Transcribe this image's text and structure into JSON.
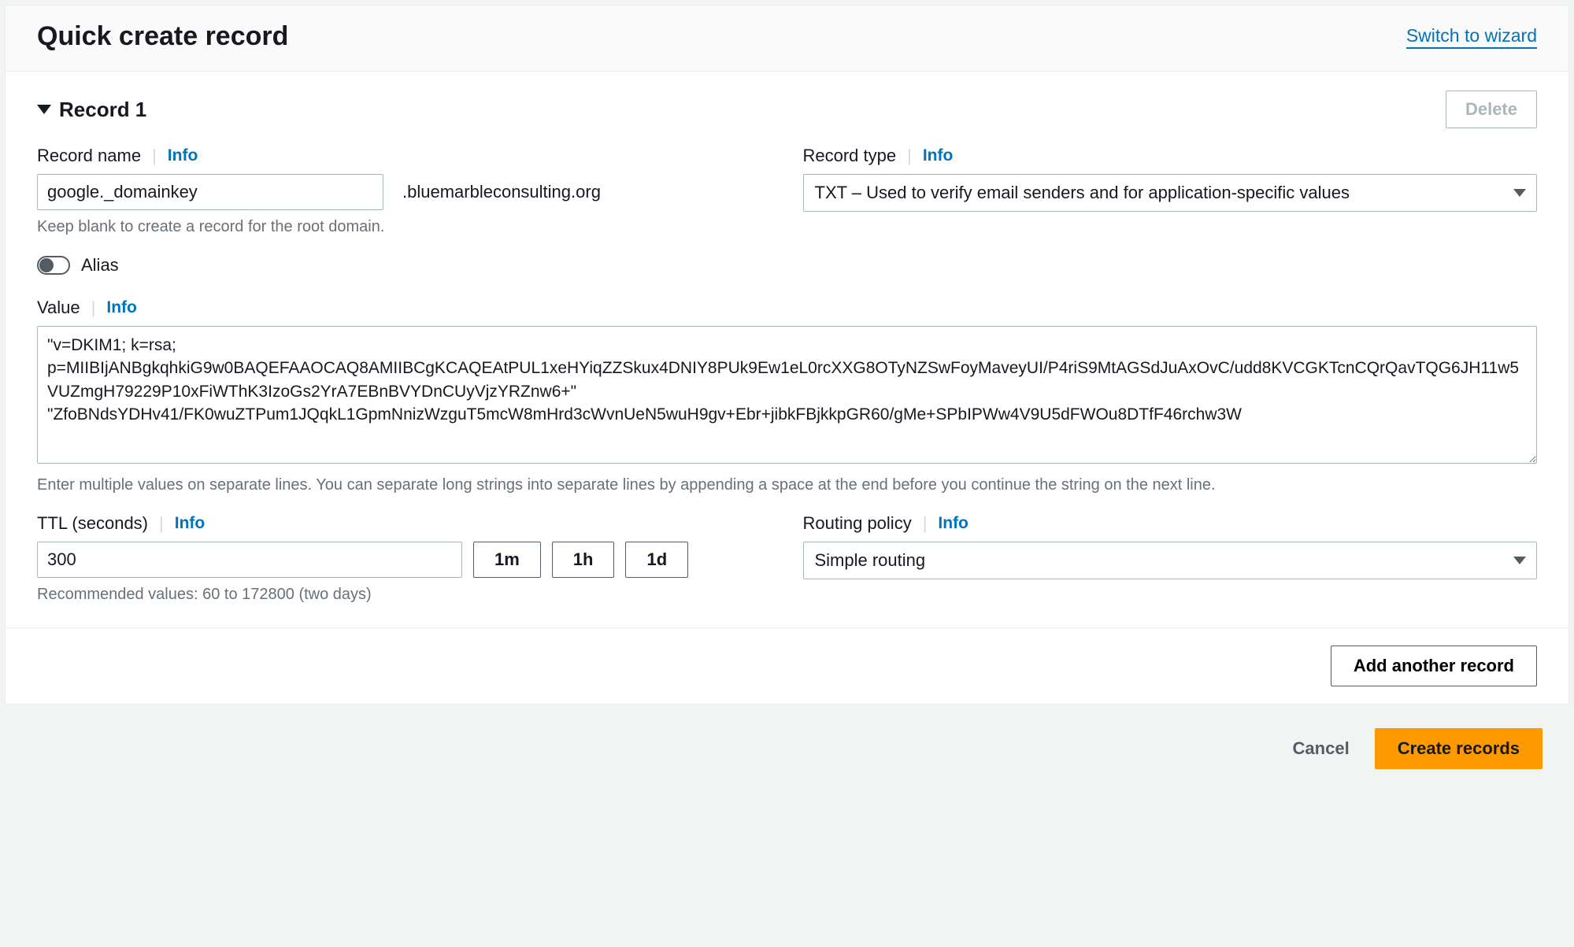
{
  "header": {
    "title": "Quick create record",
    "wizard_link": "Switch to wizard"
  },
  "record": {
    "section_title": "Record 1",
    "delete_label": "Delete",
    "name": {
      "label": "Record name",
      "info": "Info",
      "value": "google._domainkey",
      "suffix": ".bluemarbleconsulting.org",
      "helper": "Keep blank to create a record for the root domain."
    },
    "type": {
      "label": "Record type",
      "info": "Info",
      "value": "TXT – Used to verify email senders and for application-specific values"
    },
    "alias": {
      "label": "Alias",
      "on": false
    },
    "value": {
      "label": "Value",
      "info": "Info",
      "text": "\"v=DKIM1; k=rsa; p=MIIBIjANBgkqhkiG9w0BAQEFAAOCAQ8AMIIBCgKCAQEAtPUL1xeHYiqZZSkux4DNIY8PUk9Ew1eL0rcXXG8OTyNZSwFoyMaveyUI/P4riS9MtAGSdJuAxOvC/udd8KVCGKTcnCQrQavTQG6JH11w5VUZmgH79229P10xFiWThK3IzoGs2YrA7EBnBVYDnCUyVjzYRZnw6+\"\n\"ZfoBNdsYDHv41/FK0wuZTPum1JQqkL1GpmNnizWzguT5mcW8mHrd3cWvnUeN5wuH9gv+Ebr+jibkFBjkkpGR60/gMe+SPbIPWw4V9U5dFWOu8DTfF46rchw3W",
      "helper": "Enter multiple values on separate lines. You can separate long strings into separate lines by appending a space at the end before you continue the string on the next line."
    },
    "ttl": {
      "label": "TTL (seconds)",
      "info": "Info",
      "value": "300",
      "presets": [
        "1m",
        "1h",
        "1d"
      ],
      "helper": "Recommended values: 60 to 172800 (two days)"
    },
    "routing": {
      "label": "Routing policy",
      "info": "Info",
      "value": "Simple routing"
    }
  },
  "actions": {
    "add_another": "Add another record",
    "cancel": "Cancel",
    "create": "Create records"
  }
}
